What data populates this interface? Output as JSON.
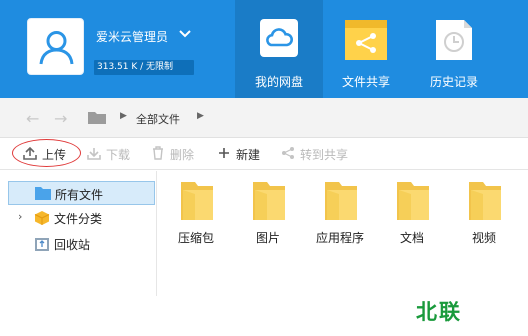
{
  "user": {
    "name": "爱米云管理员",
    "quota": "313.51 K / 无限制"
  },
  "nav": [
    {
      "label": "我的网盘",
      "icon": "cloud-icon",
      "active": true
    },
    {
      "label": "文件共享",
      "icon": "share-folder-icon",
      "active": false
    },
    {
      "label": "历史记录",
      "icon": "history-clock-icon",
      "active": false
    }
  ],
  "path": {
    "current": "全部文件"
  },
  "toolbar": {
    "upload": "上传",
    "download": "下载",
    "delete": "删除",
    "new": "新建",
    "transfer_share": "转到共享"
  },
  "sidebar": [
    {
      "label": "所有文件",
      "icon": "folder-icon"
    },
    {
      "label": "文件分类",
      "icon": "category-cube-icon"
    },
    {
      "label": "回收站",
      "icon": "recycle-bin-icon"
    }
  ],
  "files": [
    {
      "name": "压缩包"
    },
    {
      "name": "图片"
    },
    {
      "name": "应用程序"
    },
    {
      "name": "文档"
    },
    {
      "name": "视频"
    }
  ],
  "watermark": "北联",
  "colors": {
    "header": "#1f8ce0",
    "header_active_tab": "#1a7cc7",
    "folder": "#f4c84c",
    "selected_bg": "#d7ebfa",
    "watermark": "#1a9a3c"
  }
}
